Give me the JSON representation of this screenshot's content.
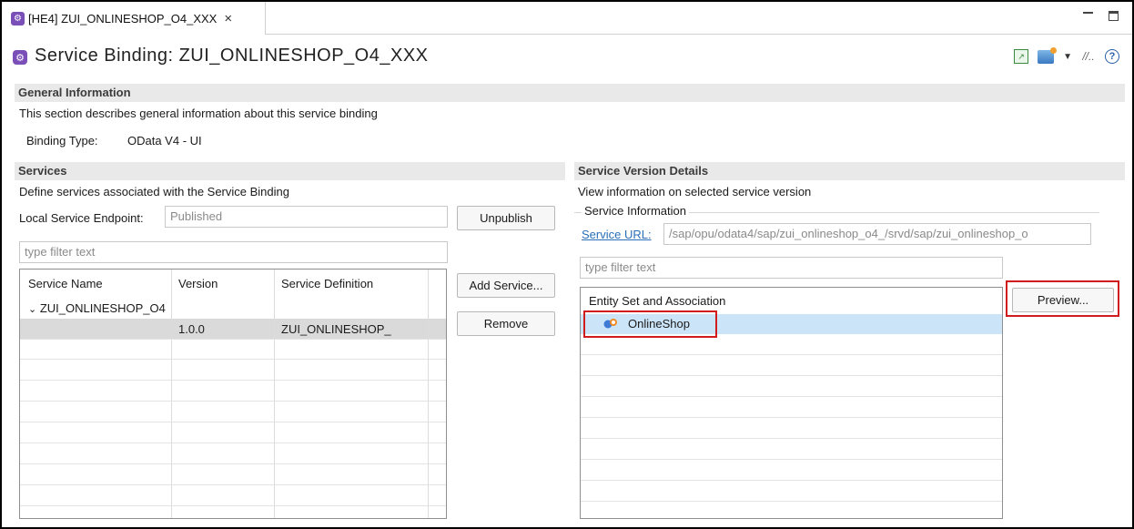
{
  "tab": {
    "label": "[HE4] ZUI_ONLINESHOP_O4_XXX",
    "close": "×"
  },
  "header": {
    "title": "Service Binding: ZUI_ONLINESHOP_O4_XXX"
  },
  "general": {
    "title": "General Information",
    "description": "This section describes general information about this service binding",
    "binding_type_label": "Binding Type:",
    "binding_type_value": "OData V4 - UI"
  },
  "services": {
    "title": "Services",
    "description": "Define services associated with the Service Binding",
    "endpoint_label": "Local Service Endpoint:",
    "endpoint_value": "Published",
    "unpublish_label": "Unpublish",
    "filter_placeholder": "type filter text",
    "add_service_label": "Add Service...",
    "remove_label": "Remove",
    "columns": [
      "Service Name",
      "Version",
      "Service Definition"
    ],
    "tree_node": "ZUI_ONLINESHOP_O4",
    "row": {
      "version": "1.0.0",
      "definition": "ZUI_ONLINESHOP_"
    }
  },
  "version_details": {
    "title": "Service Version Details",
    "description": "View information on selected service version",
    "group_label": "Service Information",
    "service_url_label": "Service URL:",
    "service_url_value": "/sap/opu/odata4/sap/zui_onlineshop_o4_/srvd/sap/zui_onlineshop_o",
    "filter_placeholder": "type filter text",
    "entity_header": "Entity Set and Association",
    "entity_item": "OnlineShop",
    "preview_label": "Preview..."
  },
  "colors": {
    "highlight": "#d01c1c",
    "selection": "#cce4f7",
    "link": "#2a6fb8"
  }
}
